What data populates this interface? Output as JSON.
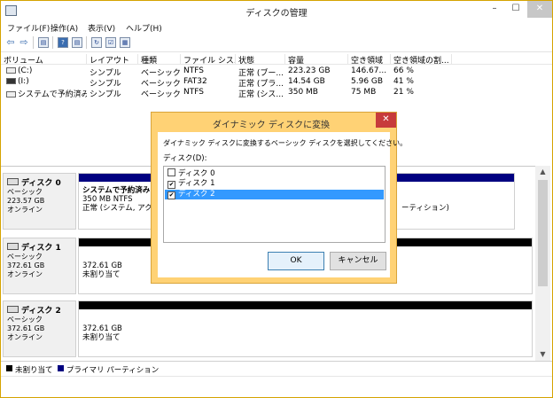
{
  "window": {
    "title": "ディスクの管理",
    "min": "–",
    "max": "☐",
    "close": "✕"
  },
  "menu": [
    "ファイル(F)",
    "操作(A)",
    "表示(V)",
    "ヘルプ(H)"
  ],
  "toolbar": {
    "back": "⇦",
    "forward": "⇨",
    "b1": "▤",
    "b2": "?",
    "b3": "▤",
    "b4": "↻",
    "b5": "☑",
    "b6": "▦"
  },
  "columns": [
    "ボリューム",
    "レイアウト",
    "種類",
    "ファイル シス...",
    "状態",
    "容量",
    "空き領域",
    "空き領域の割..."
  ],
  "volumes": [
    {
      "name": "(C:)",
      "layout": "シンプル",
      "type": "ベーシック",
      "fs": "NTFS",
      "status": "正常 (ブー...",
      "capacity": "223.23 GB",
      "free": "146.67...",
      "pct": "66 %"
    },
    {
      "name": "(I:)",
      "layout": "シンプル",
      "type": "ベーシック",
      "fs": "FAT32",
      "status": "正常 (プラ...",
      "capacity": "14.54 GB",
      "free": "5.96 GB",
      "pct": "41 %"
    },
    {
      "name": "システムで予約済み",
      "layout": "シンプル",
      "type": "ベーシック",
      "fs": "NTFS",
      "status": "正常 (シス...",
      "capacity": "350 MB",
      "free": "75 MB",
      "pct": "21 %"
    }
  ],
  "disks": [
    {
      "name": "ディスク 0",
      "type": "ベーシック",
      "size": "223.57 GB",
      "state": "オンライン",
      "part_title": "システムで予約済み",
      "part_line2": "350 MB NTFS",
      "part_line3": "正常 (システム, アクテ",
      "part_right": "ーティション)"
    },
    {
      "name": "ディスク 1",
      "type": "ベーシック",
      "size": "372.61 GB",
      "state": "オンライン",
      "part_line1": "372.61 GB",
      "part_line2": "未割り当て"
    },
    {
      "name": "ディスク 2",
      "type": "ベーシック",
      "size": "372.61 GB",
      "state": "オンライン",
      "part_line1": "372.61 GB",
      "part_line2": "未割り当て"
    }
  ],
  "legend": {
    "unallocated": "未割り当て",
    "primary": "プライマリ パーティション"
  },
  "colors": {
    "unallocated": "#000000",
    "primary": "#000080",
    "dialog_frame": "#ffd275",
    "selection": "#3399ff"
  },
  "dialog": {
    "title": "ダイナミック ディスクに変換",
    "close": "✕",
    "description": "ダイナミック ディスクに変換するベーシック ディスクを選択してください。",
    "list_label": "ディスク(D):",
    "items": [
      {
        "label": "ディスク 0",
        "checked": false,
        "selected": false
      },
      {
        "label": "ディスク 1",
        "checked": true,
        "selected": false
      },
      {
        "label": "ディスク 2",
        "checked": true,
        "selected": true
      }
    ],
    "ok": "OK",
    "cancel": "キャンセル"
  }
}
